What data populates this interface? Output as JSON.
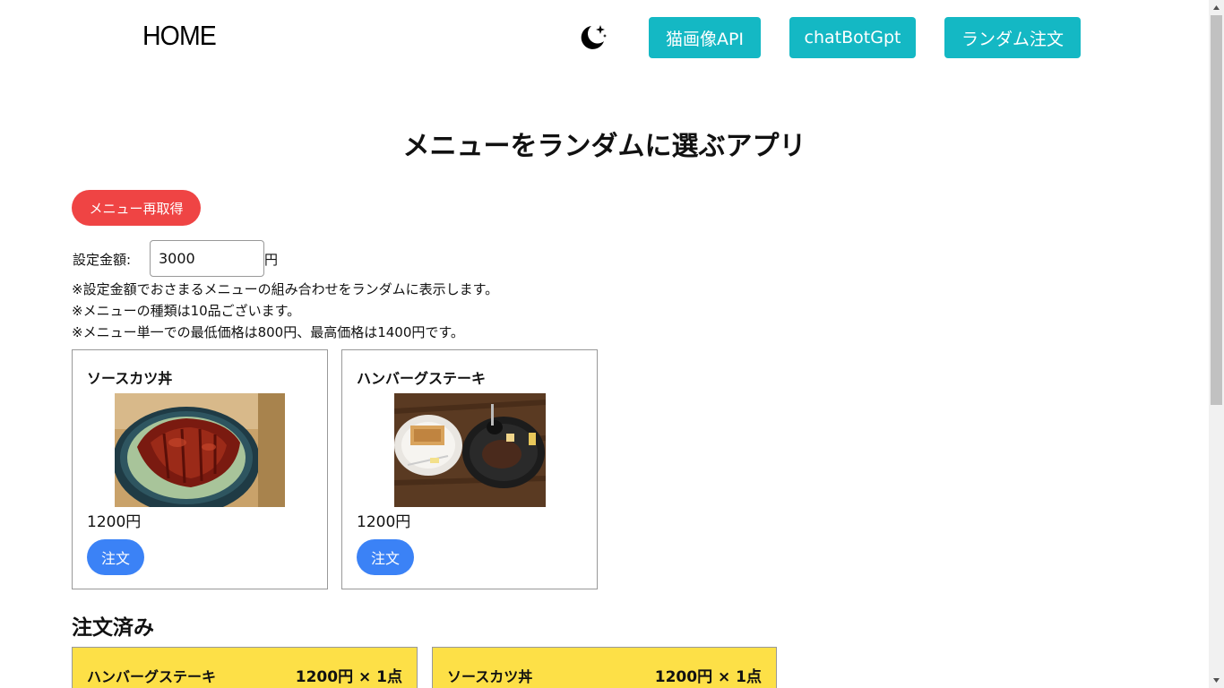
{
  "header": {
    "home": "HOME",
    "theme_icon": "moon-stars-icon",
    "nav": [
      "猫画像API",
      "chatBotGpt",
      "ランダム注文"
    ]
  },
  "page_title": "メニューをランダムに選ぶアプリ",
  "refresh_label": "メニュー再取得",
  "amount": {
    "label": "設定金額:",
    "value": "3000",
    "unit": "円"
  },
  "notes": [
    "※設定金額でおさまるメニューの組み合わせをランダムに表示します。",
    "※メニューの種類は10品ございます。",
    "※メニュー単一での最低価格は800円、最高価格は1400円です。"
  ],
  "menu_items": [
    {
      "name": "ソースカツ丼",
      "price": "1200円",
      "order_label": "注文"
    },
    {
      "name": "ハンバーグステーキ",
      "price": "1200円",
      "order_label": "注文"
    }
  ],
  "ordered": {
    "title": "注文済み",
    "items": [
      {
        "name": "ハンバーグステーキ",
        "price_qty": "1200円 × 1点"
      },
      {
        "name": "ソースカツ丼",
        "price_qty": "1200円 × 1点"
      }
    ]
  },
  "colors": {
    "nav_button": "#14b8c4",
    "refresh_button": "#ef4444",
    "order_button": "#3b82f6",
    "ordered_card": "#fde047"
  }
}
